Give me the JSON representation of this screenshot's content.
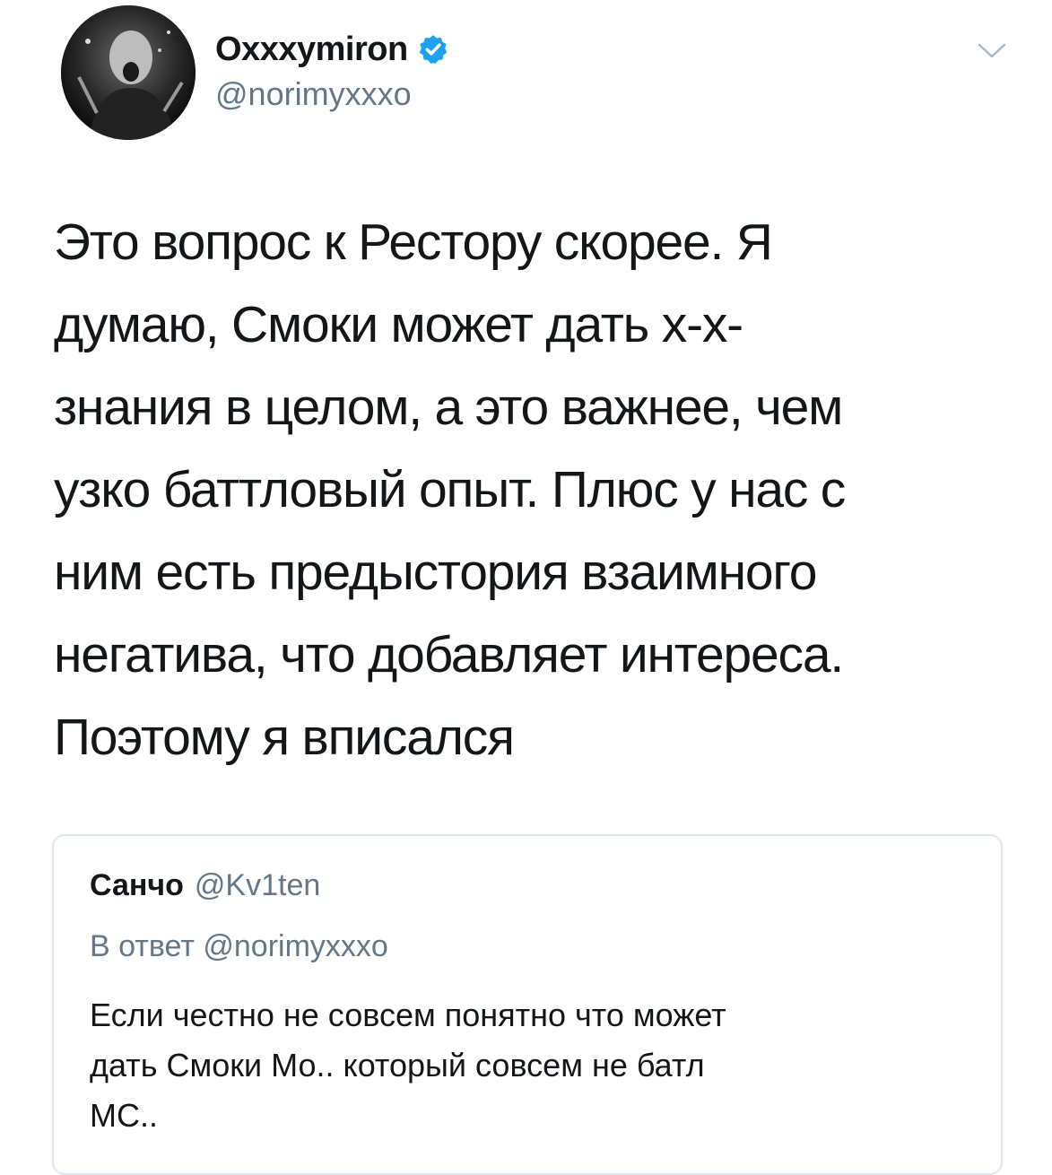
{
  "tweet": {
    "display_name": "Oxxxymiron",
    "handle": "@norimyxxxo",
    "verified": true,
    "text_lines": [
      "Это вопрос к Рестору скорее. Я",
      "думаю, Смоки может дать х-х-",
      "знания в целом, а это важнее, чем",
      "узко баттловый опыт. Плюс у нас с",
      "ним есть предыстория взаимного",
      "негатива, что добавляет интереса.",
      "Поэтому я вписался"
    ]
  },
  "quoted_tweet": {
    "display_name": "Санчо",
    "handle": "@Kv1ten",
    "reply_prefix": "В ответ",
    "reply_to": "@norimyxxxo",
    "text_lines": [
      "Если честно не совсем понятно что может",
      "дать Смоки Мо.. который совсем не батл",
      "МС.."
    ]
  },
  "icons": {
    "avatar": "user-avatar",
    "verified": "verified-badge-icon",
    "menu": "chevron-down-icon"
  },
  "colors": {
    "text": "#14171a",
    "secondary": "#657786",
    "verified": "#1da1f2",
    "border": "#e1e8ed"
  }
}
